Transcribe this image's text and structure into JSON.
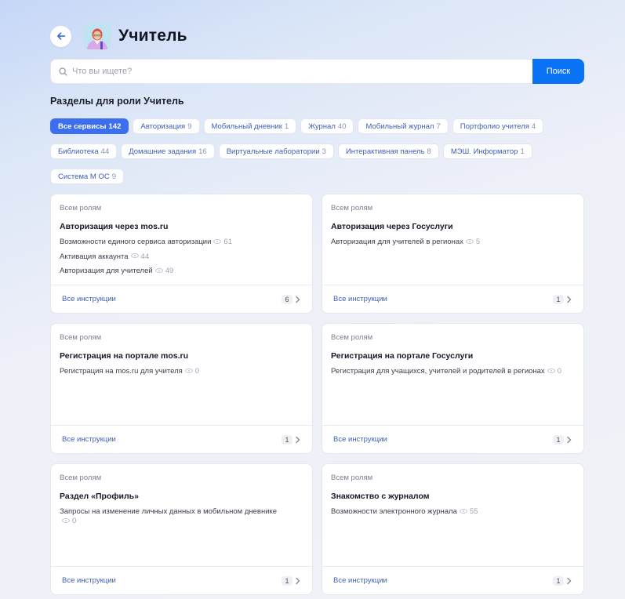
{
  "header": {
    "title": "Учитель",
    "back_icon": "arrow-left-icon",
    "avatar": "teacher-avatar"
  },
  "search": {
    "placeholder": "Что вы ищете?",
    "value": "",
    "button_label": "Поиск"
  },
  "section_title": "Разделы для роли Учитель",
  "chips": [
    {
      "label": "Все сервисы",
      "count": "142",
      "active": true
    },
    {
      "label": "Авторизация",
      "count": "9"
    },
    {
      "label": "Мобильный дневник",
      "count": "1"
    },
    {
      "label": "Журнал",
      "count": "40"
    },
    {
      "label": "Мобильный журнал",
      "count": "7"
    },
    {
      "label": "Портфолио учителя",
      "count": "4"
    },
    {
      "label": "Библиотека",
      "count": "44"
    },
    {
      "label": "Домашние задания",
      "count": "16"
    },
    {
      "label": "Виртуальные лаборатории",
      "count": "3"
    },
    {
      "label": "Интерактивная панель",
      "count": "8"
    },
    {
      "label": "МЭШ. Информатор",
      "count": "1"
    },
    {
      "label": "Система М ОС",
      "count": "9"
    }
  ],
  "cards": [
    {
      "role": "Всем ролям",
      "title": "Авторизация через mos.ru",
      "items": [
        {
          "text": "Возможности единого сервиса авторизации",
          "views": "61"
        },
        {
          "text": "Активация аккаунта",
          "views": "44"
        },
        {
          "text": "Авторизация для учителей",
          "views": "49"
        }
      ],
      "link": "Все инструкции",
      "count": "6"
    },
    {
      "role": "Всем ролям",
      "title": "Авторизация через Госуслуги",
      "items": [
        {
          "text": "Авторизация для учителей в регионах",
          "views": "5"
        }
      ],
      "link": "Все инструкции",
      "count": "1"
    },
    {
      "role": "Всем ролям",
      "title": "Регистрация на портале mos.ru",
      "items": [
        {
          "text": "Регистрация на mos.ru для учителя",
          "views": "0"
        }
      ],
      "link": "Все инструкции",
      "count": "1"
    },
    {
      "role": "Всем ролям",
      "title": "Регистрация на портале Госуслуги",
      "items": [
        {
          "text": "Регистрация для учащихся, учителей и родителей в регионах",
          "views": "0"
        }
      ],
      "link": "Все инструкции",
      "count": "1"
    },
    {
      "role": "Всем ролям",
      "title": "Раздел «Профиль»",
      "items": [
        {
          "text": "Запросы на изменение личных данных в мобильном дневнике",
          "views": "0"
        }
      ],
      "link": "Все инструкции",
      "count": "1"
    },
    {
      "role": "Всем ролям",
      "title": "Знакомство с журналом",
      "items": [
        {
          "text": "Возможности электронного журнала",
          "views": "55"
        }
      ],
      "link": "Все инструкции",
      "count": "1"
    }
  ],
  "colors": {
    "accent": "#0a73f5",
    "chip_active": "#3b6ff0",
    "link": "#3d5fb8"
  }
}
